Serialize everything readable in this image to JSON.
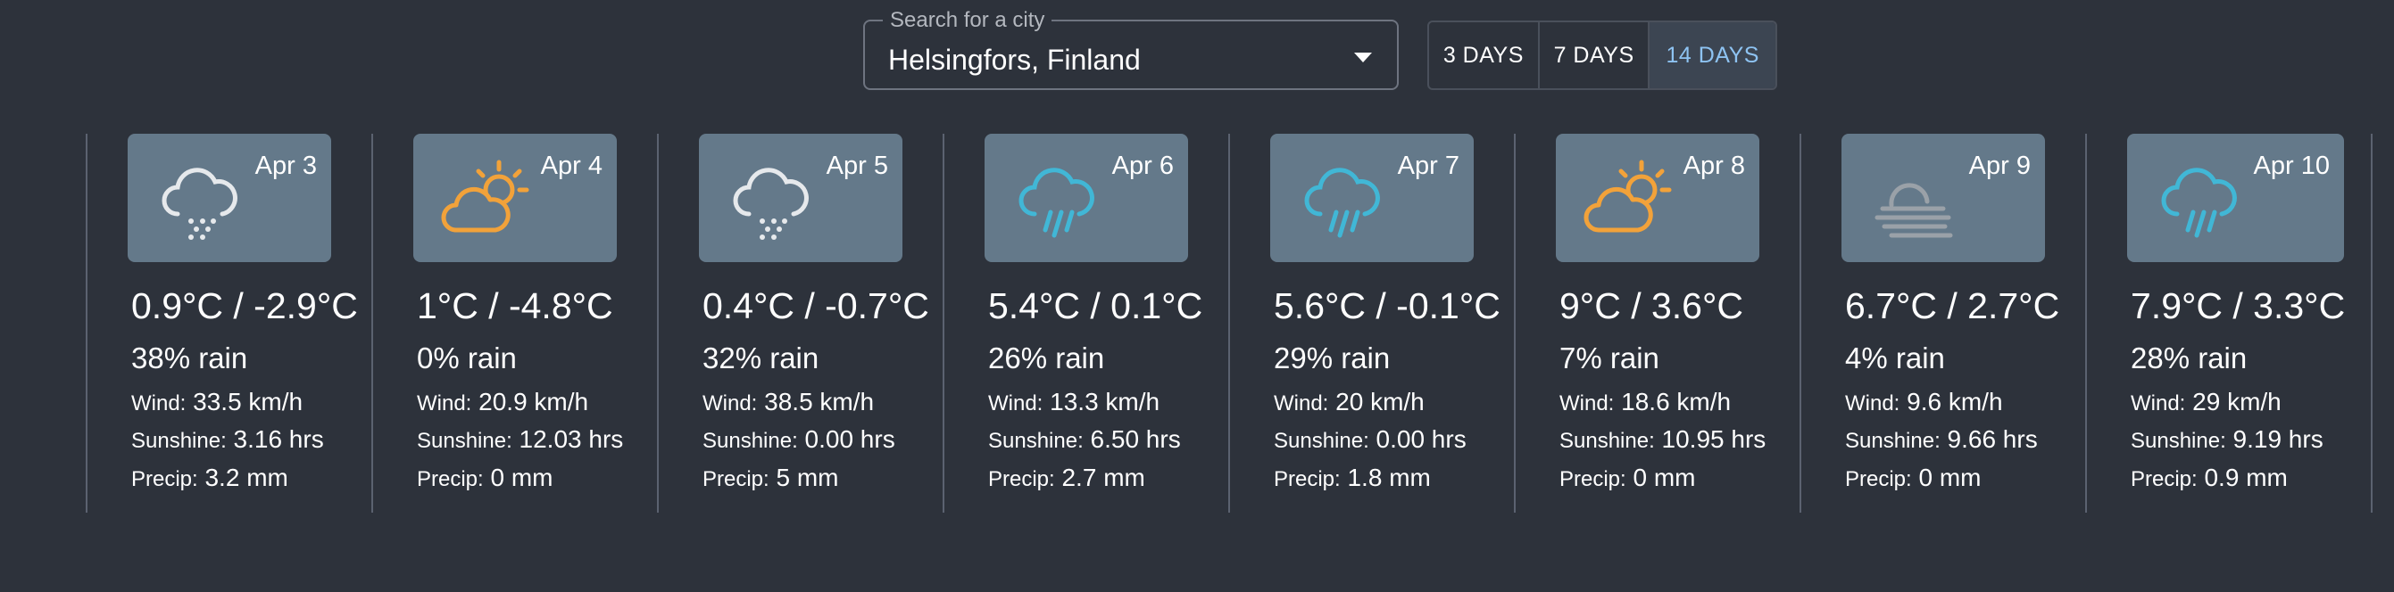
{
  "search": {
    "label": "Search for a city",
    "value": "Helsingfors, Finland"
  },
  "range": {
    "options": [
      "3 DAYS",
      "7 DAYS",
      "14 DAYS"
    ],
    "selected": "14 DAYS",
    "selected_color": "#8ec3f2"
  },
  "labels": {
    "wind": "Wind:",
    "sunshine": "Sunshine:",
    "precip": "Precip:"
  },
  "colors": {
    "background": "#2d323b",
    "tile": "#64798a",
    "sun": "#f2a23a",
    "rain_icon": "#41b7d6",
    "cloud_outline": "#e6e9ec",
    "fog": "#9aa1a8"
  },
  "days": [
    {
      "date": "Apr 3",
      "icon": "snow-cloud-icon",
      "temps": "0.9°C / -2.9°C",
      "rain": "38% rain",
      "wind": "33.5 km/h",
      "sunshine": "3.16 hrs",
      "precip": "3.2 mm"
    },
    {
      "date": "Apr 4",
      "icon": "partly-cloudy-sun-icon",
      "temps": "1°C / -4.8°C",
      "rain": "0% rain",
      "wind": "20.9 km/h",
      "sunshine": "12.03 hrs",
      "precip": "0 mm"
    },
    {
      "date": "Apr 5",
      "icon": "snow-cloud-icon",
      "temps": "0.4°C / -0.7°C",
      "rain": "32% rain",
      "wind": "38.5 km/h",
      "sunshine": "0.00 hrs",
      "precip": "5 mm"
    },
    {
      "date": "Apr 6",
      "icon": "rain-cloud-icon",
      "temps": "5.4°C / 0.1°C",
      "rain": "26% rain",
      "wind": "13.3 km/h",
      "sunshine": "6.50 hrs",
      "precip": "2.7 mm"
    },
    {
      "date": "Apr 7",
      "icon": "rain-cloud-icon",
      "temps": "5.6°C / -0.1°C",
      "rain": "29% rain",
      "wind": "20 km/h",
      "sunshine": "0.00 hrs",
      "precip": "1.8 mm"
    },
    {
      "date": "Apr 8",
      "icon": "partly-cloudy-sun-icon",
      "temps": "9°C / 3.6°C",
      "rain": "7% rain",
      "wind": "18.6 km/h",
      "sunshine": "10.95 hrs",
      "precip": "0 mm"
    },
    {
      "date": "Apr 9",
      "icon": "fog-cloud-icon",
      "temps": "6.7°C / 2.7°C",
      "rain": "4% rain",
      "wind": "9.6 km/h",
      "sunshine": "9.66 hrs",
      "precip": "0 mm"
    },
    {
      "date": "Apr 10",
      "icon": "rain-cloud-icon",
      "temps": "7.9°C / 3.3°C",
      "rain": "28% rain",
      "wind": "29 km/h",
      "sunshine": "9.19 hrs",
      "precip": "0.9 mm"
    }
  ]
}
